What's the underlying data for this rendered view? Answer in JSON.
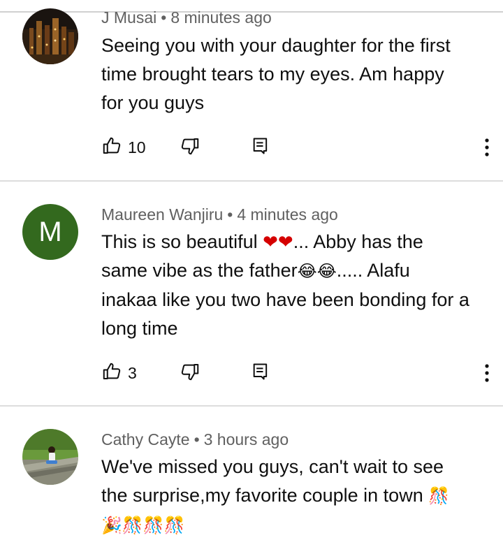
{
  "comments": [
    {
      "author": "J Musai",
      "time": "8 minutes ago",
      "text_lines": [
        "Seeing you with your daughter for the first",
        "time brought tears to my eyes. Am happy",
        "for you guys"
      ],
      "likes": "10",
      "avatar": "city-night-photo"
    },
    {
      "author": "Maureen Wanjiru",
      "time": "4 minutes ago",
      "avatar_letter": "M",
      "avatar_color": "#33691e",
      "text_parts": {
        "a": "This is so beautiful ",
        "emoji_a": "❤❤",
        "b": "...  Abby has the",
        "c": "same vibe as the father",
        "emoji_b": "😂😂",
        "d": "..... Alafu",
        "e": "inakaa like you two have been bonding for a",
        "f": "long time"
      },
      "likes": "3"
    },
    {
      "author": "Cathy Cayte",
      "time": "3 hours ago",
      "avatar": "person-on-grass-photo",
      "text_lines": [
        "We've missed you guys, can't wait to see",
        "the surprise,my favorite couple in town "
      ],
      "emoji_line1": "🎊",
      "emoji_line2": "🎉🎊🎊🎊"
    }
  ],
  "icons": {
    "like": "thumbs-up-icon",
    "dislike": "thumbs-down-icon",
    "reply": "comment-reply-icon",
    "more": "more-vertical-icon"
  },
  "separator": "•"
}
